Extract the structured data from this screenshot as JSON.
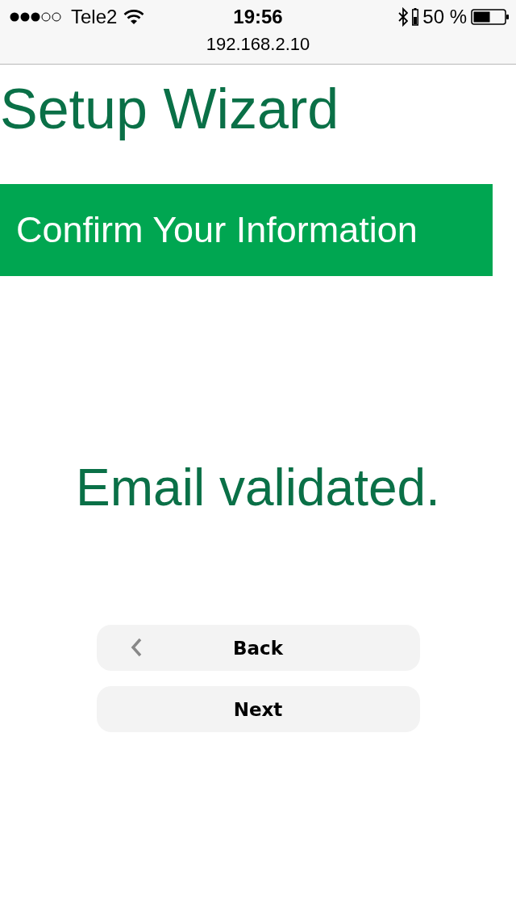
{
  "status_bar": {
    "carrier": "Tele2",
    "time": "19:56",
    "battery": "50 %"
  },
  "address_bar": {
    "url": "192.168.2.10"
  },
  "title": "Setup Wizard",
  "banner": "Confirm Your Information",
  "message": "Email validated.",
  "buttons": [
    {
      "label": "Back",
      "kind": "back"
    },
    {
      "label": "Next",
      "kind": "plain"
    }
  ]
}
